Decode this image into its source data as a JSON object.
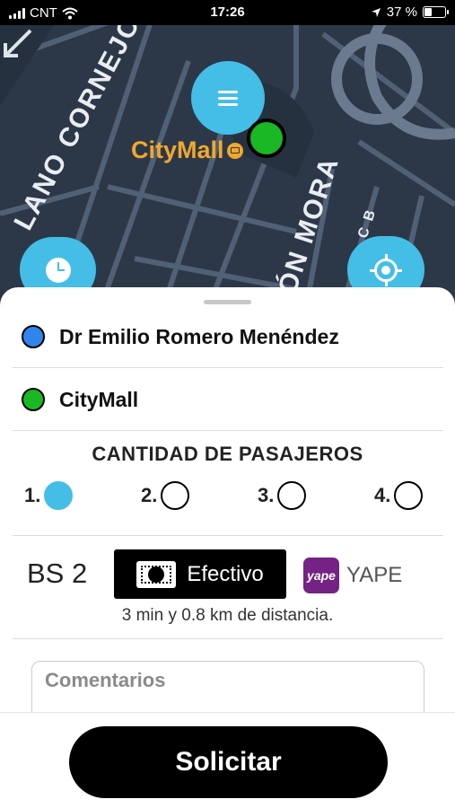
{
  "status_bar": {
    "carrier": "CNT",
    "time": "17:26",
    "battery": "37 %",
    "battery_level": 0.37
  },
  "map": {
    "streets": [
      "LANO CORNEJO",
      "ÓN MORA",
      "C B"
    ],
    "poi_label": "CityMall",
    "fab_colors": {
      "accent": "#44bee6",
      "destination": "#19b824",
      "map_bg": "#2c3848"
    },
    "icons": [
      "menu-icon",
      "clock-icon",
      "target-location-icon"
    ]
  },
  "route": {
    "origin": "Dr Emilio Romero Menéndez",
    "destination": "CityMall"
  },
  "passengers": {
    "title": "CANTIDAD DE PASAJEROS",
    "options": [
      "1.",
      "2.",
      "3.",
      "4."
    ],
    "selected": "1."
  },
  "fare": {
    "price": "BS 2",
    "cash_label": "Efectivo",
    "yape_logo": "yape",
    "yape_label": "YAPE",
    "distance_text": "3 min y 0.8 km de distancia."
  },
  "comments": {
    "placeholder": "Comentarios"
  },
  "request_button": "Solicitar"
}
